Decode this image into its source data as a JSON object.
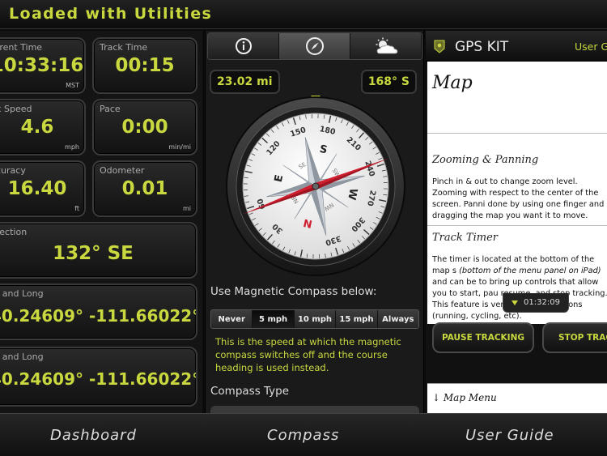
{
  "header": {
    "title": "Loaded with Utilities"
  },
  "dashboard": {
    "tiles": [
      {
        "label": "rrent Time",
        "value": "10:33:16",
        "unit": "MST"
      },
      {
        "label": "Track Time",
        "value": "00:15",
        "unit": ""
      },
      {
        "label": "x Speed",
        "value": "4.6",
        "unit": "mph"
      },
      {
        "label": "Pace",
        "value": "0:00",
        "unit": "min/mi"
      },
      {
        "label": "curacy",
        "value": "16.40",
        "unit": "ft"
      },
      {
        "label": "Odometer",
        "value": "0.01",
        "unit": "mi"
      },
      {
        "label": "rection",
        "value": "132° SE",
        "unit": ""
      },
      {
        "label": "t and Long",
        "value": "40.24609° -111.66022°",
        "unit": ""
      },
      {
        "label": "t and Long",
        "value": "40.24609° -111.66022°",
        "unit": ""
      }
    ]
  },
  "compass": {
    "tabs": [
      {
        "name": "info-icon"
      },
      {
        "name": "compass-icon"
      },
      {
        "name": "weather-icon"
      }
    ],
    "active_tab": 1,
    "distance": "23.02 mi",
    "heading": "168° S",
    "dial": {
      "cardinals": [
        "N",
        "E",
        "S",
        "W"
      ],
      "degree_labels": [
        "30",
        "60",
        "120",
        "150",
        "180",
        "210",
        "240",
        "270",
        "300",
        "330"
      ],
      "intercardinals": [
        "NE",
        "SE",
        "SW",
        "NW"
      ]
    },
    "magnetic_label": "Use Magnetic Compass below:",
    "speed_options": [
      "Never",
      "5 mph",
      "10 mph",
      "15 mph",
      "Always"
    ],
    "selected_speed": 1,
    "note": "This is the speed at which the magnetic compass switches off and the course heading is used instead.",
    "compass_type_label": "Compass Type"
  },
  "guide": {
    "app_name": "GPS KIT",
    "header_link": "User G",
    "title": "Map",
    "sections": [
      {
        "heading": "Zooming & Panning",
        "text": "Pinch in & out to change zoom level. Zooming with respect to the center of the screen. Panni done by using one finger and dragging the map you want it to move."
      },
      {
        "heading": "Track Timer",
        "text_1": "The timer is located at the bottom of the map s",
        "text_2": "(bottom of the menu panel on iPad)",
        "text_3": "and can be to bring up controls that allow you to start, pau resume, and stop tracking. This feature is very timed expeditions (running, cycling, etc)."
      }
    ],
    "timer": "01:32:09",
    "pause_button": "PAUSE TRACKING",
    "stop_button": "STOP TRAC",
    "menu_label": "Map Menu"
  },
  "bottom_nav": [
    "Dashboard",
    "Compass",
    "User Guide"
  ],
  "colors": {
    "accent": "#c9d83f",
    "needle": "#d01f2f"
  }
}
